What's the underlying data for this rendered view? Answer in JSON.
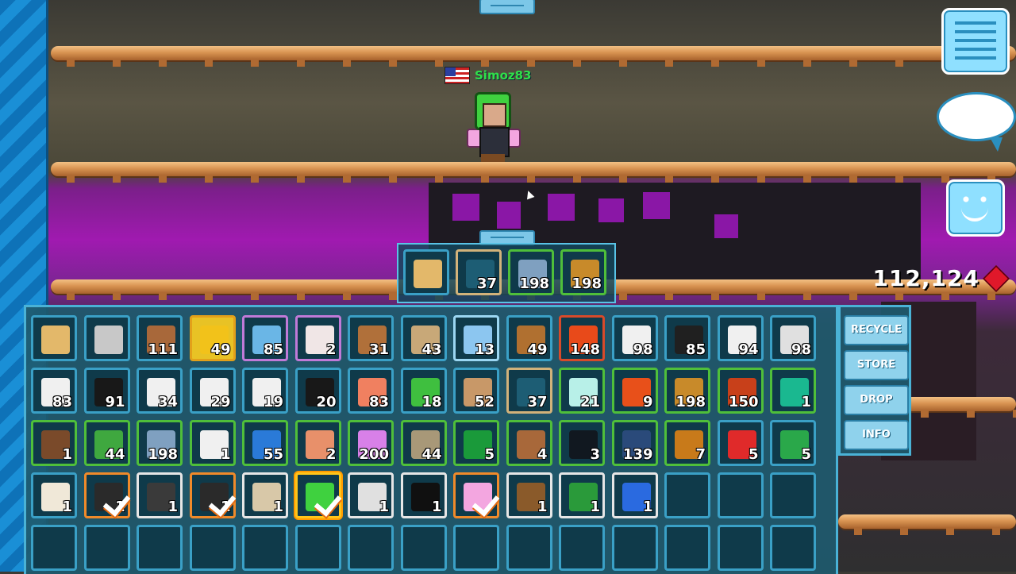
{
  "player": {
    "name": "Simoz83",
    "flag": "us-flag-icon"
  },
  "gems": {
    "count": "112,124",
    "icon": "gem-icon",
    "color": "#e0182a"
  },
  "hud": {
    "menu_icon": "list-icon",
    "chat_icon": "chat-bubble-icon",
    "emote_icon": "smiley-icon"
  },
  "quickbar": [
    {
      "icon": "fist-icon",
      "count": "",
      "color": "#e3b86a",
      "style": ""
    },
    {
      "icon": "glass-pane-icon",
      "count": "37",
      "color": "#1d5d74",
      "style": "tan"
    },
    {
      "icon": "seed-icon",
      "count": "198",
      "color": "#7fa0c0",
      "style": "green"
    },
    {
      "icon": "seed-icon",
      "count": "198",
      "color": "#c88a2a",
      "style": "green"
    }
  ],
  "side_menu": {
    "recycle": "RECYCLE",
    "store": "STORE",
    "drop": "DROP",
    "info": "INFO"
  },
  "inventory": [
    [
      {
        "icon": "fist-icon",
        "count": "",
        "color": "#e3b86a",
        "style": ""
      },
      {
        "icon": "wrench-icon",
        "count": "",
        "color": "#c8c8c8",
        "style": ""
      },
      {
        "icon": "door-icon",
        "count": "111",
        "color": "#a8683a",
        "style": ""
      },
      {
        "icon": "lock-icon",
        "count": "49",
        "color": "#f2c21a",
        "style": "gold"
      },
      {
        "icon": "bucket-icon",
        "count": "85",
        "color": "#6ab6e6",
        "style": "purple"
      },
      {
        "icon": "megaphone-icon",
        "count": "2",
        "color": "#f0e6e6",
        "style": "purple"
      },
      {
        "icon": "door-icon",
        "count": "31",
        "color": "#b0703a",
        "style": ""
      },
      {
        "icon": "sign-icon",
        "count": "43",
        "color": "#c8a878",
        "style": ""
      },
      {
        "icon": "music-note-icon",
        "count": "13",
        "color": "#8cc6f0",
        "style": "lightblue"
      },
      {
        "icon": "shelf-icon",
        "count": "49",
        "color": "#b07030",
        "style": ""
      },
      {
        "icon": "lava-icon",
        "count": "148",
        "color": "#e84a1a",
        "style": "red"
      },
      {
        "icon": "diagonal-block-icon",
        "count": "98",
        "color": "#f0f0f0",
        "style": ""
      },
      {
        "icon": "diagonal-block-icon",
        "count": "85",
        "color": "#202020",
        "style": ""
      },
      {
        "icon": "half-block-icon",
        "count": "94",
        "color": "#f0f0f0",
        "style": ""
      },
      {
        "icon": "half-block-icon",
        "count": "98",
        "color": "#e0e0e0",
        "style": ""
      }
    ],
    [
      {
        "icon": "half-block-icon",
        "count": "83",
        "color": "#f0f0f0",
        "style": ""
      },
      {
        "icon": "half-block-icon",
        "count": "91",
        "color": "#181818",
        "style": ""
      },
      {
        "icon": "target-block-icon",
        "count": "34",
        "color": "#f0f0f0",
        "style": ""
      },
      {
        "icon": "stripe-block-icon",
        "count": "29",
        "color": "#f0f0f0",
        "style": ""
      },
      {
        "icon": "stripe-block-icon",
        "count": "19",
        "color": "#f0f0f0",
        "style": ""
      },
      {
        "icon": "target-block-icon",
        "count": "20",
        "color": "#181818",
        "style": ""
      },
      {
        "icon": "bacon-block-icon",
        "count": "83",
        "color": "#f08060",
        "style": ""
      },
      {
        "icon": "bamboo-icon",
        "count": "18",
        "color": "#3fbf3f",
        "style": ""
      },
      {
        "icon": "wood-sign-icon",
        "count": "52",
        "color": "#c89868",
        "style": ""
      },
      {
        "icon": "glass-pane-icon",
        "count": "37",
        "color": "#1d5d74",
        "style": "tan"
      },
      {
        "icon": "egg-icon",
        "count": "21",
        "color": "#b8f0e8",
        "style": "green"
      },
      {
        "icon": "seed-icon",
        "count": "9",
        "color": "#e8501a",
        "style": "green"
      },
      {
        "icon": "seed-icon",
        "count": "198",
        "color": "#c88a2a",
        "style": "green"
      },
      {
        "icon": "seed-icon",
        "count": "150",
        "color": "#c8401a",
        "style": "green"
      },
      {
        "icon": "seed-icon",
        "count": "1",
        "color": "#1ab890",
        "style": "green"
      }
    ],
    [
      {
        "icon": "seed-icon",
        "count": "1",
        "color": "#7a4a2a",
        "style": "green"
      },
      {
        "icon": "seed-icon",
        "count": "44",
        "color": "#3fa83f",
        "style": "green"
      },
      {
        "icon": "seed-icon",
        "count": "198",
        "color": "#7fa0c0",
        "style": "green"
      },
      {
        "icon": "seed-icon",
        "count": "1",
        "color": "#f0f0f0",
        "style": "green"
      },
      {
        "icon": "seed-icon",
        "count": "55",
        "color": "#2a7ad8",
        "style": "green"
      },
      {
        "icon": "seed-icon",
        "count": "2",
        "color": "#e8906a",
        "style": "green"
      },
      {
        "icon": "seed-icon",
        "count": "200",
        "color": "#d880e8",
        "style": "green"
      },
      {
        "icon": "seed-icon",
        "count": "44",
        "color": "#a89878",
        "style": "green"
      },
      {
        "icon": "seed-icon",
        "count": "5",
        "color": "#1a9a3a",
        "style": "green"
      },
      {
        "icon": "seed-icon",
        "count": "4",
        "color": "#a8683a",
        "style": "green"
      },
      {
        "icon": "seed-icon",
        "count": "3",
        "color": "#111820",
        "style": "green"
      },
      {
        "icon": "seed-icon",
        "count": "139",
        "color": "#2a4a7a",
        "style": "green"
      },
      {
        "icon": "seed-icon",
        "count": "7",
        "color": "#c87a1a",
        "style": "green"
      },
      {
        "icon": "potion-icon",
        "count": "5",
        "color": "#e02a2a",
        "style": ""
      },
      {
        "icon": "tree-orb-icon",
        "count": "5",
        "color": "#2aa84a",
        "style": ""
      }
    ],
    [
      {
        "icon": "sand-icon",
        "count": "1",
        "color": "#f0e8d8",
        "style": ""
      },
      {
        "icon": "clothing-icon",
        "count": "1",
        "color": "#2a2a2a",
        "style": "orange",
        "checked": true
      },
      {
        "icon": "clothing-icon",
        "count": "1",
        "color": "#3a3a3a",
        "style": "white"
      },
      {
        "icon": "clothing-icon",
        "count": "1",
        "color": "#2a2a2a",
        "style": "orange",
        "checked": true
      },
      {
        "icon": "dagger-icon",
        "count": "1",
        "color": "#d8c8a8",
        "style": "white"
      },
      {
        "icon": "frog-hat-icon",
        "count": "",
        "color": "#3fd13f",
        "style": "selected",
        "checked": true
      },
      {
        "icon": "knife-icon",
        "count": "1",
        "color": "#e0e0e0",
        "style": "white"
      },
      {
        "icon": "sunglasses-icon",
        "count": "1",
        "color": "#101010",
        "style": "white"
      },
      {
        "icon": "wings-icon",
        "count": "",
        "color": "#f3a6e0",
        "style": "orange",
        "checked": true
      },
      {
        "icon": "bear-mask-icon",
        "count": "1",
        "color": "#8a5a2a",
        "style": "white"
      },
      {
        "icon": "tractor-icon",
        "count": "1",
        "color": "#2a9a3a",
        "style": "white"
      },
      {
        "icon": "gun-icon",
        "count": "1",
        "color": "#2a6ae0",
        "style": "white"
      },
      {
        "icon": "",
        "count": "",
        "color": "",
        "style": ""
      },
      {
        "icon": "",
        "count": "",
        "color": "",
        "style": ""
      },
      {
        "icon": "",
        "count": "",
        "color": "",
        "style": ""
      }
    ],
    [
      {
        "icon": "",
        "count": "",
        "color": "",
        "style": ""
      },
      {
        "icon": "",
        "count": "",
        "color": "",
        "style": ""
      },
      {
        "icon": "",
        "count": "",
        "color": "",
        "style": ""
      },
      {
        "icon": "",
        "count": "",
        "color": "",
        "style": ""
      },
      {
        "icon": "",
        "count": "",
        "color": "",
        "style": ""
      },
      {
        "icon": "",
        "count": "",
        "color": "",
        "style": ""
      },
      {
        "icon": "",
        "count": "",
        "color": "",
        "style": ""
      },
      {
        "icon": "",
        "count": "",
        "color": "",
        "style": ""
      },
      {
        "icon": "",
        "count": "",
        "color": "",
        "style": ""
      },
      {
        "icon": "",
        "count": "",
        "color": "",
        "style": ""
      },
      {
        "icon": "",
        "count": "",
        "color": "",
        "style": ""
      },
      {
        "icon": "",
        "count": "",
        "color": "",
        "style": ""
      },
      {
        "icon": "",
        "count": "",
        "color": "",
        "style": ""
      },
      {
        "icon": "",
        "count": "",
        "color": "",
        "style": ""
      },
      {
        "icon": "",
        "count": "",
        "color": "",
        "style": ""
      }
    ]
  ]
}
